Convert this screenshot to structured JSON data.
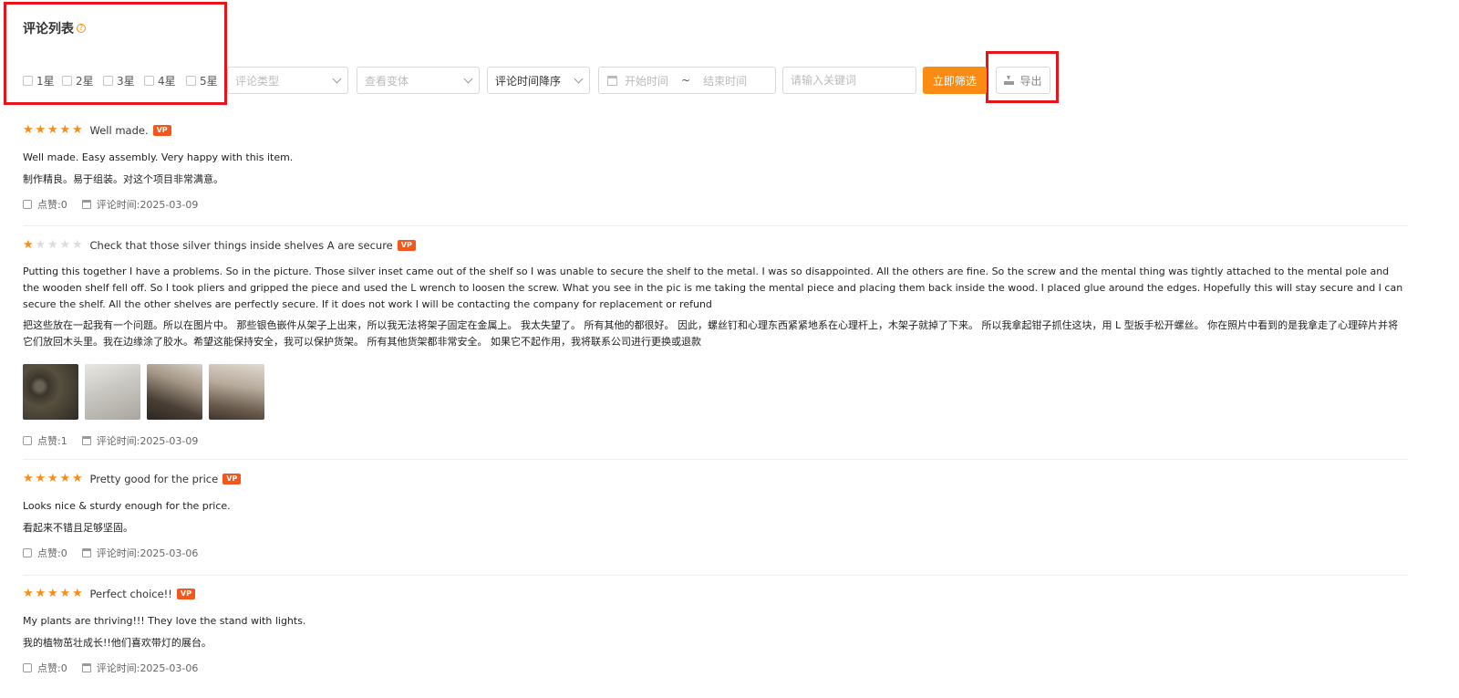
{
  "header": {
    "title": "评论列表",
    "help_icon": "question-circle-icon"
  },
  "filters": {
    "stars": [
      "1星",
      "2星",
      "3星",
      "4星",
      "5星"
    ],
    "review_type_placeholder": "评论类型",
    "variant_placeholder": "查看变体",
    "sort_value": "评论时间降序",
    "start_placeholder": "开始时间",
    "range_separator": "~",
    "end_placeholder": "结束时间",
    "keyword_placeholder": "请输入关键词",
    "filter_button": "立即筛选",
    "export_button": "导出"
  },
  "labels": {
    "likes": "点赞: ",
    "time": "评论时间: ",
    "vp": "VP"
  },
  "colors": {
    "accent": "#fa8c16",
    "vp_badge": "#f5561b",
    "highlight_box": "#e8141b"
  },
  "reviews": [
    {
      "rating": 5,
      "title": "Well made.",
      "text_en": "Well made. Easy assembly. Very happy with this item.",
      "text_cn": "制作精良。易于组装。对这个项目非常满意。",
      "likes": "0",
      "date": "2025-03-09",
      "photos": 0
    },
    {
      "rating": 1,
      "title": "Check that those silver things inside shelves A are secure",
      "text_en": "Putting this together I have a problems. So in the picture. Those silver inset came out of the shelf so I was unable to secure the shelf to the metal. I was so disappointed. All the others are fine. So the screw and the mental thing was tightly attached to the mental pole and the wooden shelf fell off. So I took pliers and gripped the piece and used the L wrench to loosen the screw. What you see in the pic is me taking the mental piece and placing them back inside the wood. I placed glue around the edges. Hopefully this will stay secure and I can secure the shelf. All the other shelves are perfectly secure. If it does not work I will be contacting the company for replacement or refund",
      "text_cn": "把这些放在一起我有一个问题。所以在图片中。 那些银色嵌件从架子上出来，所以我无法将架子固定在金属上。 我太失望了。 所有其他的都很好。 因此，螺丝钉和心理东西紧紧地系在心理杆上，木架子就掉了下来。 所以我拿起钳子抓住这块，用 L 型扳手松开螺丝。 你在照片中看到的是我拿走了心理碎片并将它们放回木头里。我在边缘涂了胶水。希望这能保持安全，我可以保护货架。 所有其他货架都非常安全。 如果它不起作用，我将联系公司进行更换或退款",
      "likes": "1",
      "date": "2025-03-09",
      "photos": 4
    },
    {
      "rating": 5,
      "title": "Pretty good for the price",
      "text_en": "Looks nice & sturdy enough for the price.",
      "text_cn": "看起来不错且足够坚固。",
      "likes": "0",
      "date": "2025-03-06",
      "photos": 0
    },
    {
      "rating": 5,
      "title": "Perfect choice!!",
      "text_en": "My plants are thriving!!! They love the stand with lights.",
      "text_cn": "我的植物茁壮成长!!他们喜欢带灯的展台。",
      "likes": "0",
      "date": "2025-03-06",
      "photos": 0
    }
  ]
}
